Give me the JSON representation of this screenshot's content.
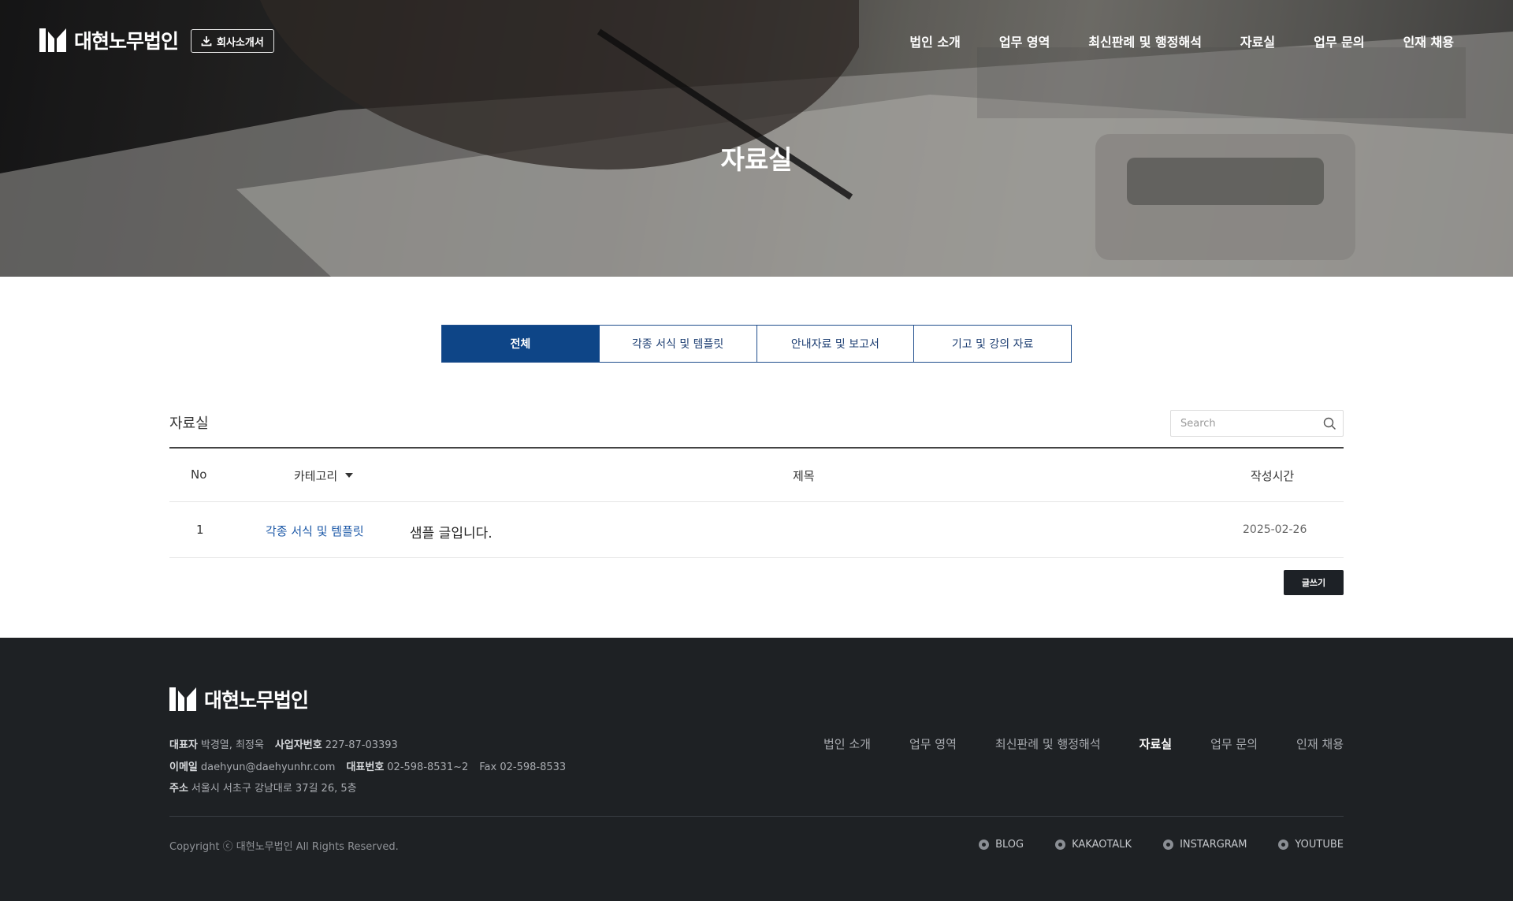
{
  "header": {
    "logo_text": "대현노무법인",
    "brochure_label": "회사소개서",
    "nav": [
      "법인 소개",
      "업무 영역",
      "최신판례 및 행정해석",
      "자료실",
      "업무 문의",
      "인재 채용"
    ],
    "active_nav": "자료실"
  },
  "hero": {
    "title": "자료실"
  },
  "tabs": [
    "전체",
    "각종 서식 및 템플릿",
    "안내자료 및 보고서",
    "기고 및 강의 자료"
  ],
  "active_tab": "전체",
  "board": {
    "title": "자료실",
    "search_placeholder": "Search",
    "columns": {
      "no": "No",
      "category": "카테고리",
      "title": "제목",
      "date": "작성시간"
    },
    "rows": [
      {
        "no": "1",
        "category": "각종 서식 및 템플릿",
        "title": "샘플 글입니다.",
        "date": "2025-02-26"
      }
    ],
    "write_label": "글쓰기"
  },
  "footer": {
    "logo_text": "대현노무법인",
    "rep_label": "대표자",
    "rep_value": "박경열, 최정욱",
    "biz_label": "사업자번호",
    "biz_value": "227-87-03393",
    "email_label": "이메일",
    "email_value": "daehyun@daehyunhr.com",
    "phone_label": "대표번호",
    "phone_value": "02-598-8531~2",
    "fax_text": "Fax 02-598-8533",
    "addr_label": "주소",
    "addr_value": "서울시 서초구 강남대로 37길 26, 5층",
    "nav": [
      "법인 소개",
      "업무 영역",
      "최신판례 및 행정해석",
      "자료실",
      "업무 문의",
      "인재 채용"
    ],
    "copyright": "Copyright ⓒ 대현노무법인 All Rights Reserved.",
    "socials": [
      "BLOG",
      "KAKAOTALK",
      "INSTARGRAM",
      "YOUTUBE"
    ]
  },
  "colors": {
    "primary": "#0e4587",
    "category_link": "#1e5aa8",
    "footer_bg": "#1e2124",
    "write_button": "#1d2126"
  }
}
